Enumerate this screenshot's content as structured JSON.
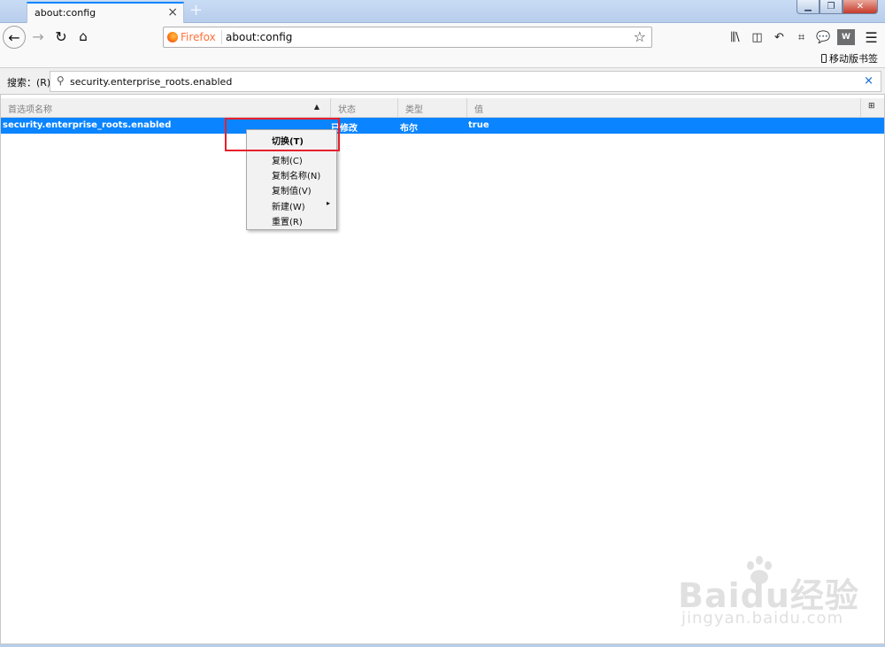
{
  "browser": {
    "tab": {
      "title": "about:config",
      "close": "×"
    },
    "new_tab": "+",
    "window_controls": {
      "minimize": "▁",
      "restore": "❐",
      "close": "✕"
    },
    "nav": {
      "back": "←",
      "forward": "→",
      "reload": "↻",
      "home": "⌂"
    },
    "urlbar": {
      "identity": "Firefox",
      "url": "about:config",
      "bookmark_star": "☆"
    },
    "toolbar": {
      "library": "⫼\\",
      "sidebar": "◫",
      "undo": "↶",
      "screenshot": "⌗",
      "chat": "💬",
      "wp_label": "W",
      "menu": "☰"
    },
    "mobile_bookmarks": "移动版书签"
  },
  "search": {
    "label": "搜索：(R)",
    "value": "security.enterprise_roots.enabled",
    "clear": "×"
  },
  "table": {
    "columns": {
      "name": "首选项名称",
      "status": "状态",
      "type": "类型",
      "value": "值"
    },
    "sort_arrow": "▲",
    "column_picker": "⊞",
    "rows": [
      {
        "name": "security.enterprise_roots.enabled",
        "status": "已修改",
        "type": "布尔",
        "value": "true"
      }
    ]
  },
  "context_menu": {
    "toggle": "切换(T)",
    "copy": "复制(C)",
    "copy_name": "复制名称(N)",
    "copy_value": "复制值(V)",
    "new": "新建(W)",
    "new_arrow": "▸",
    "reset": "重置(R)"
  },
  "watermark": {
    "brand": "Baidu经验",
    "url": "jingyan.baidu.com"
  },
  "colors": {
    "accent": "#0a84ff",
    "highlight": "#e8202a",
    "identity": "#ff7139"
  }
}
